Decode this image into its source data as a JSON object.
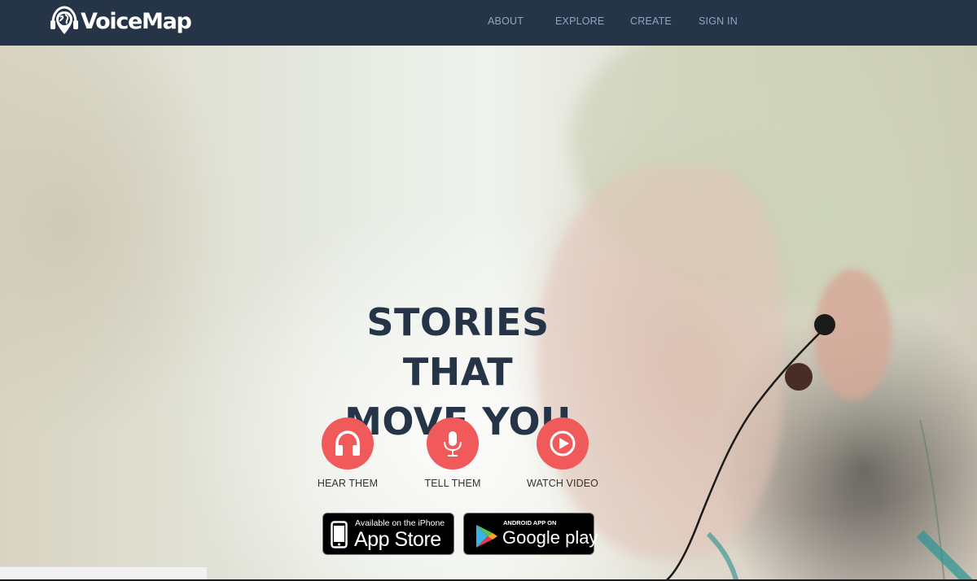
{
  "brand": {
    "name": "VoiceMap",
    "logo_icon": "globe-pin-headphones-icon"
  },
  "nav": {
    "items": [
      {
        "label": "ABOUT"
      },
      {
        "label": "EXPLORE"
      },
      {
        "label": "CREATE"
      },
      {
        "label": "SIGN IN"
      }
    ]
  },
  "hero": {
    "headline_line1": "STORIES THAT",
    "headline_line2": "MOVE YOU",
    "actions": [
      {
        "label": "HEAR THEM",
        "icon": "headphones-icon"
      },
      {
        "label": "TELL THEM",
        "icon": "microphone-icon"
      },
      {
        "label": "WATCH VIDEO",
        "icon": "play-circle-icon"
      }
    ],
    "badges": {
      "apple": {
        "small": "Available on the iPhone",
        "big": "App Store",
        "icon": "iphone-icon"
      },
      "google": {
        "small": "ANDROID APP ON",
        "big_1": "Google",
        "big_2": "play",
        "icon": "google-play-triangle-icon"
      }
    }
  },
  "colors": {
    "navbar": "#253446",
    "nav_text": "#8ea6c6",
    "accent": "#f05a5b",
    "headline": "#253446"
  }
}
